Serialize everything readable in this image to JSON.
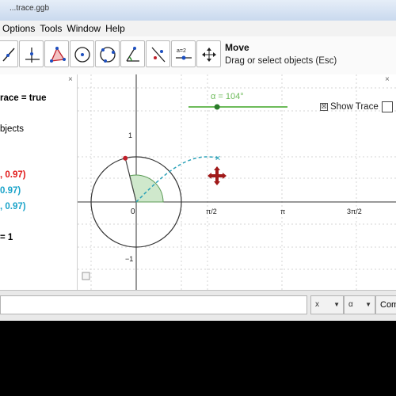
{
  "window": {
    "title": "...trace.ggb"
  },
  "menu": [
    "Options",
    "Tools",
    "Window",
    "Help"
  ],
  "toolbar": {
    "tools": [
      "line-tool",
      "perpendicular-tool",
      "polygon-tool",
      "circle-tool",
      "circle-three-points-tool",
      "angle-tool",
      "reflect-tool",
      "slider-tool",
      "move-graphics-tool"
    ],
    "slider_icon_label": "a=2",
    "selected_tool_name": "Move",
    "selected_tool_hint": "Drag or select objects (Esc)"
  },
  "algebra": {
    "close": "×",
    "lines": [
      {
        "text": "race = true",
        "color": "#000000",
        "bold": true
      },
      {
        "text": "bjects",
        "color": "#000000",
        "bold": false
      },
      {
        "text": ", 0.97)",
        "color": "#e01818",
        "bold": true
      },
      {
        "text": "0.97)",
        "color": "#1aa3c9",
        "bold": true
      },
      {
        "text": ", 0.97)",
        "color": "#1aa3c9",
        "bold": true
      },
      {
        "text": "= 1",
        "color": "#000000",
        "bold": true
      }
    ]
  },
  "graphics": {
    "close": "×",
    "slider_label": "α = 104°",
    "slider_value_deg": 104,
    "show_trace_checked": "☒",
    "show_trace_label": "Show Trace",
    "axis_labels": {
      "origin": "0",
      "x_ticks": [
        "π/2",
        "π",
        "3π/2"
      ],
      "y_top": "1",
      "y_bottom": "−1"
    },
    "trace_marker": "×",
    "colors": {
      "slider": "#6dbb5a",
      "trace": "#2aa1b8",
      "sector": "#cfe8cc",
      "point_red": "#c0202a",
      "move_cursor": "#a01818"
    }
  },
  "status": {
    "input_value": "",
    "dropdown1": "x",
    "dropdown2": "α",
    "command_label": "Com"
  }
}
